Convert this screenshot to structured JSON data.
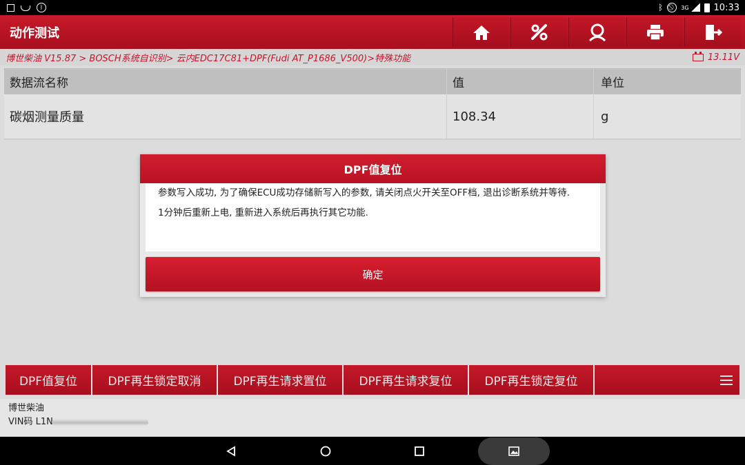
{
  "statusbar": {
    "time": "10:33",
    "network": "3G",
    "icons": [
      "image-icon",
      "usb-icon",
      "bluetooth-badge-icon",
      "bluetooth-icon",
      "no-sim-icon",
      "signal-icon",
      "battery-icon"
    ]
  },
  "header": {
    "title": "动作测试",
    "tools": [
      "home-icon",
      "diagnostic-icon",
      "user-icon",
      "print-icon",
      "exit-icon"
    ]
  },
  "breadcrumb": {
    "path": "博世柴油 V15.87 > BOSCH系统自识别> 云内EDC17C81+DPF(Fudi AT_P1686_V500)>特殊功能",
    "voltage": "13.11V"
  },
  "table": {
    "headers": [
      "数据流名称",
      "值",
      "单位"
    ],
    "rows": [
      {
        "name": "碳烟测量质量",
        "value": "108.34",
        "unit": "g"
      }
    ]
  },
  "dialog": {
    "title": "DPF值复位",
    "message1": "参数写入成功, 为了确保ECU成功存储新写入的参数, 请关闭点火开关至OFF档, 退出诊断系统并等待.",
    "message2": "1分钟后重新上电, 重新进入系统后再执行其它功能.",
    "ok_label": "确定"
  },
  "functions": [
    "DPF值复位",
    "DPF再生锁定取消",
    "DPF再生请求置位",
    "DPF再生请求复位",
    "DPF再生锁定复位"
  ],
  "info": {
    "vehicle": "博世柴油",
    "vin_prefix": "VIN码 L1N"
  },
  "colors": {
    "accent": "#c41829",
    "breadcrumb_text": "#c8142a"
  }
}
